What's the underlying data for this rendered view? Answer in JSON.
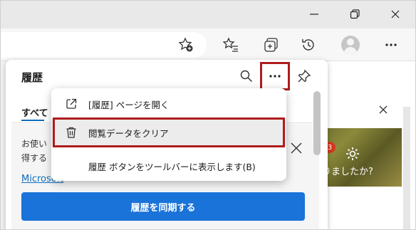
{
  "panel": {
    "title": "履歴",
    "tabs": [
      {
        "label": "すべて"
      }
    ],
    "body_text_line1": "お使い",
    "body_text_line2": "得する",
    "link_text": "Microsoft",
    "sync_button_label": "履歴を同期する"
  },
  "menu": {
    "items": [
      {
        "label": "[履歴] ページを開く",
        "icon": "open-external-icon"
      },
      {
        "label": "閲覧データをクリア",
        "icon": "trash-icon"
      },
      {
        "label": "履歴 ボタンをツールバーに表示します(B)",
        "icon": ""
      }
    ]
  },
  "right_panel": {
    "badge_count": "3",
    "promo_text": "りましたか?"
  },
  "colors": {
    "accent": "#1a73d8",
    "highlight": "#b01c1c",
    "badge": "#d4381e"
  }
}
